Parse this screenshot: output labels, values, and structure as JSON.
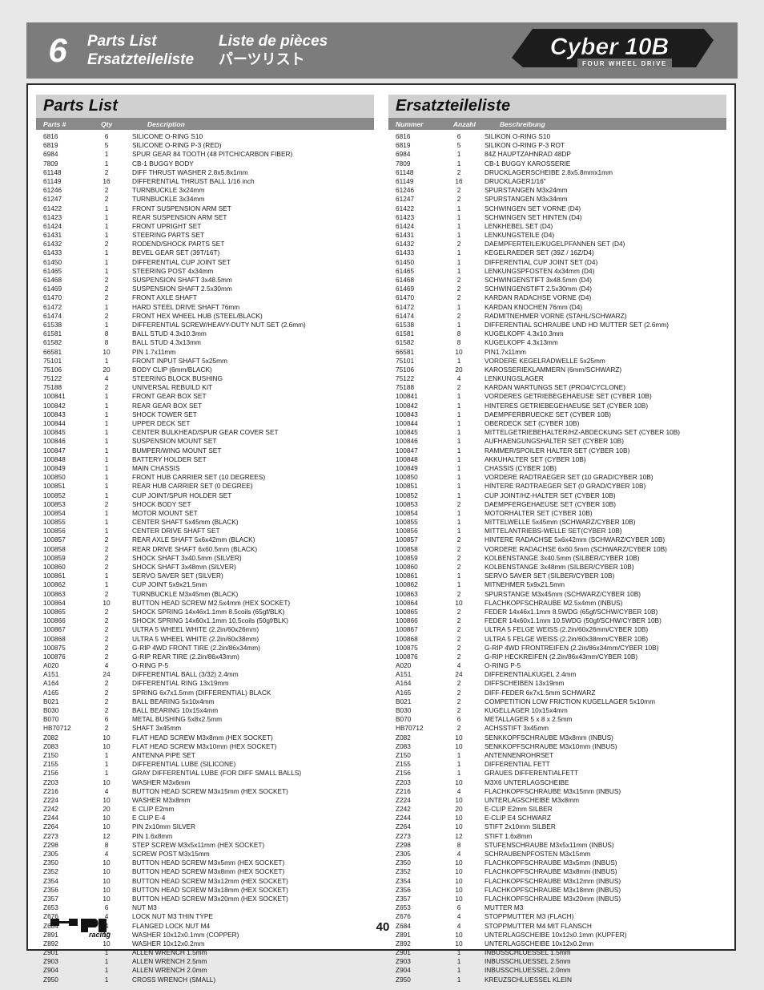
{
  "header": {
    "section_number": "6",
    "title_en": "Parts List",
    "title_de": "Ersatzteileliste",
    "title_fr": "Liste de pièces",
    "title_jp": "パーツリスト"
  },
  "brand": {
    "name": "Cyber 10B",
    "tagline": "FOUR WHEEL DRIVE"
  },
  "footer": {
    "page_number": "40",
    "logo_text": "HPI",
    "logo_sub": "racing"
  },
  "parts_list_en": {
    "title": "Parts List",
    "columns": [
      "Parts #",
      "Qty",
      "Description"
    ],
    "rows": [
      [
        "6816",
        "6",
        "SILICONE O-RING S10"
      ],
      [
        "6819",
        "5",
        "SILICONE O-RING P-3 (RED)"
      ],
      [
        "6984",
        "1",
        "SPUR GEAR 84 TOOTH (48 PITCH/CARBON FIBER)"
      ],
      [
        "7809",
        "1",
        "CB-1 BUGGY BODY"
      ],
      [
        "61148",
        "2",
        "DIFF THRUST WASHER 2.8x5.8x1mm"
      ],
      [
        "61149",
        "16",
        "DIFFERENTIAL THRUST BALL 1/16 inch"
      ],
      [
        "61246",
        "2",
        "TURNBUCKLE 3x24mm"
      ],
      [
        "61247",
        "2",
        "TURNBUCKLE 3x34mm"
      ],
      [
        "61422",
        "1",
        "FRONT SUSPENSION ARM SET"
      ],
      [
        "61423",
        "1",
        "REAR SUSPENSION ARM SET"
      ],
      [
        "61424",
        "1",
        "FRONT UPRIGHT SET"
      ],
      [
        "61431",
        "1",
        "STEERING PARTS SET"
      ],
      [
        "61432",
        "2",
        "RODEND/SHOCK PARTS SET"
      ],
      [
        "61433",
        "1",
        "BEVEL GEAR SET (39T/16T)"
      ],
      [
        "61450",
        "1",
        "DIFFERENTIAL CUP JOINT SET"
      ],
      [
        "61465",
        "1",
        "STEERING POST 4x34mm"
      ],
      [
        "61468",
        "2",
        "SUSPENSION SHAFT 3x48.5mm"
      ],
      [
        "61469",
        "2",
        "SUSPENSION SHAFT 2.5x30mm"
      ],
      [
        "61470",
        "2",
        "FRONT AXLE SHAFT"
      ],
      [
        "61472",
        "1",
        "HARD STEEL DRIVE SHAFT 76mm"
      ],
      [
        "61474",
        "2",
        "FRONT HEX WHEEL HUB (STEEL/BLACK)"
      ],
      [
        "61538",
        "1",
        "DIFFERENTIAL SCREW/HEAVY-DUTY NUT SET (2.6mm)"
      ],
      [
        "61581",
        "8",
        "BALL STUD 4.3x10.3mm"
      ],
      [
        "61582",
        "8",
        "BALL STUD 4.3x13mm"
      ],
      [
        "66581",
        "10",
        "PIN 1.7x11mm"
      ],
      [
        "75101",
        "1",
        "FRONT INPUT SHAFT 5x25mm"
      ],
      [
        "75106",
        "20",
        "BODY CLIP (6mm/BLACK)"
      ],
      [
        "75122",
        "4",
        "STEERING BLOCK BUSHING"
      ],
      [
        "75188",
        "2",
        "UNIVERSAL REBUILD KIT"
      ],
      [
        "100841",
        "1",
        "FRONT GEAR BOX SET"
      ],
      [
        "100842",
        "1",
        "REAR GEAR BOX SET"
      ],
      [
        "100843",
        "1",
        "SHOCK TOWER SET"
      ],
      [
        "100844",
        "1",
        "UPPER DECK SET"
      ],
      [
        "100845",
        "1",
        "CENTER BULKHEAD/SPUR GEAR COVER SET"
      ],
      [
        "100846",
        "1",
        "SUSPENSION MOUNT SET"
      ],
      [
        "100847",
        "1",
        "BUMPER/WING MOUNT SET"
      ],
      [
        "100848",
        "1",
        "BATTERY HOLDER SET"
      ],
      [
        "100849",
        "1",
        "MAIN CHASSIS"
      ],
      [
        "100850",
        "1",
        "FRONT HUB CARRIER SET (10 DEGREES)"
      ],
      [
        "100851",
        "1",
        "REAR HUB CARRIER SET (0 DEGREE)"
      ],
      [
        "100852",
        "1",
        "CUP JOINT/SPUR HOLDER SET"
      ],
      [
        "100853",
        "2",
        "SHOCK BODY SET"
      ],
      [
        "100854",
        "1",
        "MOTOR MOUNT SET"
      ],
      [
        "100855",
        "1",
        "CENTER SHAFT 5x45mm (BLACK)"
      ],
      [
        "100856",
        "1",
        "CENTER DRIVE SHAFT SET"
      ],
      [
        "100857",
        "2",
        "REAR AXLE SHAFT 5x6x42mm (BLACK)"
      ],
      [
        "100858",
        "2",
        "REAR DRIVE SHAFT 6x60.5mm (BLACK)"
      ],
      [
        "100859",
        "2",
        "SHOCK SHAFT 3x40.5mm (SILVER)"
      ],
      [
        "100860",
        "2",
        "SHOCK SHAFT 3x48mm (SILVER)"
      ],
      [
        "100861",
        "1",
        "SERVO SAVER SET (SILVER)"
      ],
      [
        "100862",
        "1",
        "CUP JOINT 5x9x21.5mm"
      ],
      [
        "100863",
        "2",
        "TURNBUCKLE M3x45mm (BLACK)"
      ],
      [
        "100864",
        "10",
        "BUTTON HEAD SCREW M2.5x4mm (HEX SOCKET)"
      ],
      [
        "100865",
        "2",
        "SHOCK SPRING 14x46x1.1mm 8.5coils (65gf/BLK)"
      ],
      [
        "100866",
        "2",
        "SHOCK SPRING 14x60x1.1mm 10.5coils (50gf/BLK)"
      ],
      [
        "100867",
        "2",
        "ULTRA 5 WHEEL WHITE (2.2in/60x26mm)"
      ],
      [
        "100868",
        "2",
        "ULTRA 5 WHEEL WHITE (2.2in/60x38mm)"
      ],
      [
        "100875",
        "2",
        "G-RIP 4WD FRONT TIRE (2.2in/86x34mm)"
      ],
      [
        "100876",
        "2",
        "G-RIP REAR TIRE (2.2in/86x43mm)"
      ],
      [
        "A020",
        "4",
        "O-RING P-5"
      ],
      [
        "A151",
        "24",
        "DIFFERENTIAL BALL (3/32) 2.4mm"
      ],
      [
        "A164",
        "2",
        "DIFFERENTIAL RING 13x19mm"
      ],
      [
        "A165",
        "2",
        "SPRING 6x7x1.5mm (DIFFERENTIAL) BLACK"
      ],
      [
        "B021",
        "2",
        "BALL BEARING 5x10x4mm"
      ],
      [
        "B030",
        "2",
        "BALL BEARING 10x15x4mm"
      ],
      [
        "B070",
        "6",
        "METAL BUSHING 5x8x2.5mm"
      ],
      [
        "HB70712",
        "2",
        "SHAFT 3x45mm"
      ],
      [
        "Z082",
        "10",
        "FLAT HEAD SCREW M3x8mm (HEX SOCKET)"
      ],
      [
        "Z083",
        "10",
        "FLAT HEAD SCREW M3x10mm (HEX SOCKET)"
      ],
      [
        "Z150",
        "1",
        "ANTENNA PIPE SET"
      ],
      [
        "Z155",
        "1",
        "DIFFERENTIAL LUBE (SILICONE)"
      ],
      [
        "Z156",
        "1",
        "GRAY DIFFERENTIAL LUBE (FOR DIFF SMALL BALLS)"
      ],
      [
        "Z203",
        "10",
        "WASHER M3x6mm"
      ],
      [
        "Z216",
        "4",
        "BUTTON HEAD SCREW M3x15mm (HEX SOCKET)"
      ],
      [
        "Z224",
        "10",
        "WASHER M3x8mm"
      ],
      [
        "Z242",
        "20",
        "E CLIP E2mm"
      ],
      [
        "Z244",
        "10",
        "E CLIP E-4"
      ],
      [
        "Z264",
        "10",
        "PIN 2x10mm SILVER"
      ],
      [
        "Z273",
        "12",
        "PIN 1.6x8mm"
      ],
      [
        "Z298",
        "8",
        "STEP SCREW M3x5x11mm (HEX SOCKET)"
      ],
      [
        "Z305",
        "4",
        "SCREW POST M3x15mm"
      ],
      [
        "Z350",
        "10",
        "BUTTON HEAD SCREW M3x5mm (HEX SOCKET)"
      ],
      [
        "Z352",
        "10",
        "BUTTON HEAD SCREW M3x8mm (HEX SOCKET)"
      ],
      [
        "Z354",
        "10",
        "BUTTON HEAD SCREW M3x12mm (HEX SOCKET)"
      ],
      [
        "Z356",
        "10",
        "BUTTON HEAD SCREW M3x18mm (HEX SOCKET)"
      ],
      [
        "Z357",
        "10",
        "BUTTON HEAD SCREW M3x20mm (HEX SOCKET)"
      ],
      [
        "Z653",
        "6",
        "NUT M3"
      ],
      [
        "Z676",
        "4",
        "LOCK NUT M3 THIN TYPE"
      ],
      [
        "Z684",
        "4",
        "FLANGED LOCK NUT M4"
      ],
      [
        "Z891",
        "10",
        "WASHER 10x12x0.1mm (COPPER)"
      ],
      [
        "Z892",
        "10",
        "WASHER 10x12x0.2mm"
      ],
      [
        "Z901",
        "1",
        "ALLEN WRENCH 1.5mm"
      ],
      [
        "Z903",
        "1",
        "ALLEN WRENCH 2.5mm"
      ],
      [
        "Z904",
        "1",
        "ALLEN WRENCH 2.0mm"
      ],
      [
        "Z950",
        "1",
        "CROSS WRENCH (SMALL)"
      ]
    ]
  },
  "parts_list_de": {
    "title": "Ersatzteileliste",
    "columns": [
      "Nummer",
      "Anzahl",
      "Beschreibung"
    ],
    "rows": [
      [
        "6816",
        "6",
        "SILIKON O-RING S10"
      ],
      [
        "6819",
        "5",
        "SILIKON O-RING P-3 ROT"
      ],
      [
        "6984",
        "1",
        "84Z HAUPTZAHNRAD 48DP"
      ],
      [
        "7809",
        "1",
        "CB-1 BUGGY KAROSSERIE"
      ],
      [
        "61148",
        "2",
        "DRUCKLAGERSCHEIBE 2.8x5.8mmx1mm"
      ],
      [
        "61149",
        "16",
        "DRUCKLAGER1/16\""
      ],
      [
        "61246",
        "2",
        "SPURSTANGEN M3x24mm"
      ],
      [
        "61247",
        "2",
        "SPURSTANGEN M3x34mm"
      ],
      [
        "61422",
        "1",
        "SCHWINGEN SET VORNE (D4)"
      ],
      [
        "61423",
        "1",
        "SCHWINGEN SET HINTEN (D4)"
      ],
      [
        "61424",
        "1",
        "LENKHEBEL SET (D4)"
      ],
      [
        "61431",
        "1",
        "LENKUNGSTEILE (D4)"
      ],
      [
        "61432",
        "2",
        "DAEMPFERTEILE/KUGELPFANNEN SET (D4)"
      ],
      [
        "61433",
        "1",
        "KEGELRAEDER SET (39Z / 16Z/D4)"
      ],
      [
        "61450",
        "1",
        "DIFFERENTIAL CUP JOINT SET (D4)"
      ],
      [
        "61465",
        "1",
        "LENKUNGSPFOSTEN 4x34mm (D4)"
      ],
      [
        "61468",
        "2",
        "SCHWINGENSTIFT 3x48.5mm (D4)"
      ],
      [
        "61469",
        "2",
        "SCHWINGENSTIFT 2.5x30mm (D4)"
      ],
      [
        "61470",
        "2",
        "KARDAN RADACHSE VORNE (D4)"
      ],
      [
        "61472",
        "1",
        "KARDAN KNOCHEN 76mm (D4)"
      ],
      [
        "61474",
        "2",
        "RADMITNEHMER VORNE (STAHL/SCHWARZ)"
      ],
      [
        "61538",
        "1",
        "DIFFERENTIAL SCHRAUBE UND HD MUTTER SET (2.6mm)"
      ],
      [
        "61581",
        "8",
        "KUGELKOPF 4.3x10.3mm"
      ],
      [
        "61582",
        "8",
        "KUGELKOPF 4.3x13mm"
      ],
      [
        "66581",
        "10",
        "PIN1.7x11mm"
      ],
      [
        "75101",
        "1",
        "VORDERE KEGELRADWELLE 5x25mm"
      ],
      [
        "75106",
        "20",
        "KAROSSERIEKLAMMERN (6mm/SCHWARZ)"
      ],
      [
        "75122",
        "4",
        "LENKUNGSLAGER"
      ],
      [
        "75188",
        "2",
        "KARDAN WARTUNGS SET (PRO4/CYCLONE)"
      ],
      [
        "100841",
        "1",
        "VORDERES GETRIEBEGEHAEUSE SET (CYBER 10B)"
      ],
      [
        "100842",
        "1",
        "HINTERES GETRIEBEGEHAEUSE SET (CYBER 10B)"
      ],
      [
        "100843",
        "1",
        "DAEMPFERBRUECKE SET (CYBER 10B)"
      ],
      [
        "100844",
        "1",
        "OBERDECK SET (CYBER 10B)"
      ],
      [
        "100845",
        "1",
        "MITTELGETRIEBEHALTER/HZ-ABDECKUNG SET (CYBER 10B)"
      ],
      [
        "100846",
        "1",
        "AUFHAENGUNGSHALTER SET (CYBER 10B)"
      ],
      [
        "100847",
        "1",
        "RAMMER/SPOILER HALTER SET (CYBER 10B)"
      ],
      [
        "100848",
        "1",
        "AKKUHALTER SET (CYBER 10B)"
      ],
      [
        "100849",
        "1",
        "CHASSIS (CYBER 10B)"
      ],
      [
        "100850",
        "1",
        "VORDERE RADTRAEGER SET (10 GRAD/CYBER 10B)"
      ],
      [
        "100851",
        "1",
        "HINTERE RADTRAEGER SET (0 GRAD/CYBER 10B)"
      ],
      [
        "100852",
        "1",
        "CUP JOINT/HZ-HALTER SET (CYBER 10B)"
      ],
      [
        "100853",
        "2",
        "DAEMPFERGEHAEUSE SET (CYBER 10B)"
      ],
      [
        "100854",
        "1",
        "MOTORHALTER SET (CYBER 10B)"
      ],
      [
        "100855",
        "1",
        "MITTELWELLE 5x45mm (SCHWARZ/CYBER 10B)"
      ],
      [
        "100856",
        "1",
        "MITTELANTRIEBS-WELLE SET(CYBER 10B)"
      ],
      [
        "100857",
        "2",
        "HINTERE RADACHSE 5x6x42mm (SCHWARZ/CYBER 10B)"
      ],
      [
        "100858",
        "2",
        "VORDERE RADACHSE 6x60.5mm (SCHWARZ/CYBER 10B)"
      ],
      [
        "100859",
        "2",
        "KOLBENSTANGE 3x40.5mm (SILBER/CYBER 10B)"
      ],
      [
        "100860",
        "2",
        "KOLBENSTANGE 3x48mm (SILBER/CYBER 10B)"
      ],
      [
        "100861",
        "1",
        "SERVO SAVER SET (SILBER/CYBER 10B)"
      ],
      [
        "100862",
        "1",
        "MITNEHMER 5x9x21.5mm"
      ],
      [
        "100863",
        "2",
        "SPURSTANGE M3x45mm (SCHWARZ/CYBER 10B)"
      ],
      [
        "100864",
        "10",
        "FLACHKOPFSCHRAUBE M2.5x4mm (INBUS)"
      ],
      [
        "100865",
        "2",
        "FEDER 14x46x1.1mm 8.5WDG (65gf/SCHW/CYBER 10B)"
      ],
      [
        "100866",
        "2",
        "FEDER 14x60x1.1mm 10.5WDG (50gf/SCHW/CYBER 10B)"
      ],
      [
        "100867",
        "2",
        "ULTRA 5 FELGE WEISS (2.2in/60x26mm/CYBER 10B)"
      ],
      [
        "100868",
        "2",
        "ULTRA 5 FELGE WEISS (2.2in/60x38mm/CYBER 10B)"
      ],
      [
        "100875",
        "2",
        "G-RIP 4WD FRONTREIFEN (2.2in/86x34mm/CYBER 10B)"
      ],
      [
        "100876",
        "2",
        "G-RIP HECKREIFEN (2.2in/86x43mm/CYBER 10B)"
      ],
      [
        "A020",
        "4",
        "O-RING P-5"
      ],
      [
        "A151",
        "24",
        "DIFFERENTIALKUGEL 2.4mm"
      ],
      [
        "A164",
        "2",
        "DIFFSCHEIBEN 13x19mm"
      ],
      [
        "A165",
        "2",
        "DIFF-FEDER 6x7x1.5mm SCHWARZ"
      ],
      [
        "B021",
        "2",
        "COMPETITION LOW FRICTION KUGELLAGER 5x10mm"
      ],
      [
        "B030",
        "2",
        "KUGELLAGER 10x15x4mm"
      ],
      [
        "B070",
        "6",
        "METALLAGER 5 x 8 x 2.5mm"
      ],
      [
        "HB70712",
        "2",
        "ACHSSTIFT 3x45mm"
      ],
      [
        "Z082",
        "10",
        "SENKKOPFSCHRAUBE M3x8mm (INBUS)"
      ],
      [
        "Z083",
        "10",
        "SENKKOPFSCHRAUBE M3x10mm (INBUS)"
      ],
      [
        "Z150",
        "1",
        "ANTENNENROHRSET"
      ],
      [
        "Z155",
        "1",
        "DIFFERENTIAL FETT"
      ],
      [
        "Z156",
        "1",
        "GRAUES DIFFERENTIALFETT"
      ],
      [
        "Z203",
        "10",
        "M3X6 UNTERLAGSCHEIBE"
      ],
      [
        "Z216",
        "4",
        "FLACHKOPFSCHRAUBE M3x15mm (INBUS)"
      ],
      [
        "Z224",
        "10",
        "UNTERLAGSCHEIBE M3x8mm"
      ],
      [
        "Z242",
        "20",
        "E-CLIP E2mm SILBER"
      ],
      [
        "Z244",
        "10",
        "E-CLIP E4 SCHWARZ"
      ],
      [
        "Z264",
        "10",
        "STIFT 2x10mm SILBER"
      ],
      [
        "Z273",
        "12",
        "STIFT 1.6x8mm"
      ],
      [
        "Z298",
        "8",
        "STUFENSCHRAUBE M3x5x11mm (INBUS)"
      ],
      [
        "Z305",
        "4",
        "SCHRAUBENPFOSTEN M3x15mm"
      ],
      [
        "Z350",
        "10",
        "FLACHKOPFSCHRAUBE M3x5mm (INBUS)"
      ],
      [
        "Z352",
        "10",
        "FLACHKOPFSCHRAUBE M3x8mm (INBUS)"
      ],
      [
        "Z354",
        "10",
        "FLACHKOPFSCHRAUBE M3x12mm (INBUS)"
      ],
      [
        "Z356",
        "10",
        "FLACHKOPFSCHRAUBE M3x18mm (INBUS)"
      ],
      [
        "Z357",
        "10",
        "FLACHKOPFSCHRAUBE M3x20mm (INBUS)"
      ],
      [
        "Z653",
        "6",
        "MUTTER M3"
      ],
      [
        "Z676",
        "4",
        "STOPPMUTTER M3 (FLACH)"
      ],
      [
        "Z684",
        "4",
        "STOPPMUTTER M4 MIT FLANSCH"
      ],
      [
        "Z891",
        "10",
        "UNTERLAGSCHEIBE 10x12x0.1mm (KUPFER)"
      ],
      [
        "Z892",
        "10",
        "UNTERLAGSCHEIBE 10x12x0.2mm"
      ],
      [
        "Z901",
        "1",
        "INBUSSCHLUESSEL 1.5mm"
      ],
      [
        "Z903",
        "1",
        "INBUSSCHLUESSEL 2.5mm"
      ],
      [
        "Z904",
        "1",
        "INBUSSCHLUESSEL 2.0mm"
      ],
      [
        "Z950",
        "1",
        "KREUZSCHLUESSEL KLEIN"
      ]
    ]
  }
}
